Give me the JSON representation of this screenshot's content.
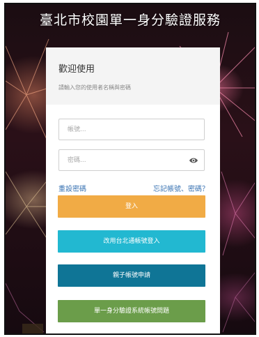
{
  "page": {
    "title": "臺北市校園單一身分驗證服務"
  },
  "login_card": {
    "welcome": "歡迎使用",
    "hint": "請輸入您的使用者名稱與密碼",
    "username_placeholder": "帳號...",
    "password_placeholder": "密碼...",
    "reset_password": "重設密碼",
    "forgot_account": "忘記帳號、密碼？",
    "login_button": "登入",
    "alt_login_button": "改用台北通帳號登入",
    "parent_account_button": "親子帳號申請",
    "faq_button": "單一身分驗證系統帳號問題"
  },
  "icons": {
    "password_toggle": "eye-icon"
  },
  "colors": {
    "login": "#f1ab45",
    "alt_login": "#22b8d1",
    "parent_account": "#0f7596",
    "faq": "#6b9d4a",
    "link": "#3b74b3"
  }
}
